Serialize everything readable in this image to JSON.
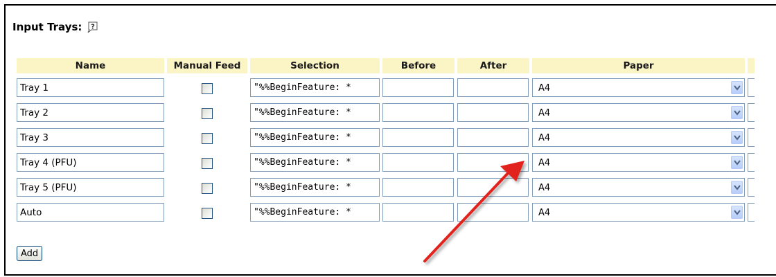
{
  "section": {
    "title": "Input Trays:",
    "help_icon": "help-question-icon"
  },
  "table": {
    "headers": [
      "Name",
      "Manual Feed",
      "Selection",
      "Before",
      "After",
      "Paper"
    ],
    "rows": [
      {
        "name": "Tray 1",
        "manual_feed": false,
        "selection": "\"%%BeginFeature: *",
        "before": "",
        "after": "",
        "paper": "A4"
      },
      {
        "name": "Tray 2",
        "manual_feed": false,
        "selection": "\"%%BeginFeature: *",
        "before": "",
        "after": "",
        "paper": "A4"
      },
      {
        "name": "Tray 3",
        "manual_feed": false,
        "selection": "\"%%BeginFeature: *",
        "before": "",
        "after": "",
        "paper": "A4"
      },
      {
        "name": "Tray 4 (PFU)",
        "manual_feed": false,
        "selection": "\"%%BeginFeature: *",
        "before": "",
        "after": "",
        "paper": "A4"
      },
      {
        "name": "Tray 5 (PFU)",
        "manual_feed": false,
        "selection": "\"%%BeginFeature: *",
        "before": "",
        "after": "",
        "paper": "A4"
      },
      {
        "name": "Auto",
        "manual_feed": false,
        "selection": "\"%%BeginFeature: *",
        "before": "",
        "after": "",
        "paper": "A4"
      }
    ]
  },
  "buttons": {
    "add_label": "Add"
  },
  "colors": {
    "header_bg": "#fbf4c4",
    "input_border": "#7f9db9",
    "annotation_arrow": "#e2231a"
  }
}
